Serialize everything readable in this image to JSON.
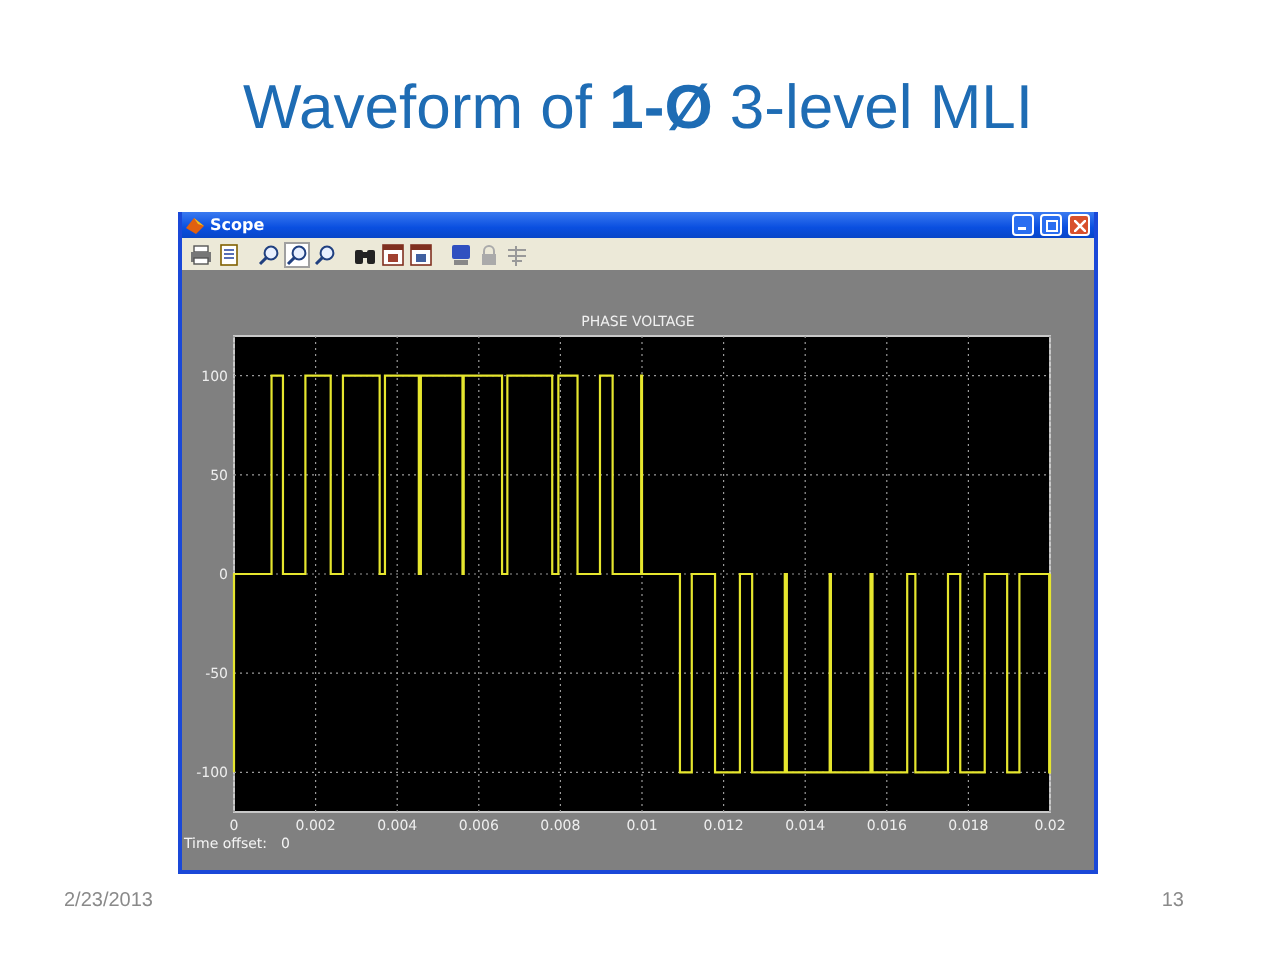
{
  "slide": {
    "title": "Waveform of **1-Ø** 3-level MLI",
    "date": "2/23/2013",
    "page_number": "13"
  },
  "scope_window": {
    "title": "Scope",
    "toolbar_buttons": [
      {
        "kind": "print",
        "selected": false
      },
      {
        "kind": "parameters",
        "selected": false
      },
      {
        "kind": "zoom",
        "selected": false
      },
      {
        "kind": "zoom",
        "selected": true
      },
      {
        "kind": "zoom",
        "selected": false
      },
      {
        "kind": "autoscale",
        "selected": false
      },
      {
        "kind": "save",
        "selected": false
      },
      {
        "kind": "restore",
        "selected": false
      },
      {
        "kind": "float",
        "selected": false
      },
      {
        "kind": "lock",
        "selected": false
      },
      {
        "kind": "signals",
        "selected": false
      }
    ],
    "plot": {
      "chart_data": {
        "type": "line",
        "grid": true,
        "title": "PHASE VOLTAGE",
        "xlim": [
          0,
          0.02
        ],
        "ylim": [
          -120,
          120
        ],
        "xticks": [
          0,
          0.002,
          0.004,
          0.006,
          0.008,
          0.01,
          0.012,
          0.014,
          0.016,
          0.018,
          0.02
        ],
        "yticks": [
          -100,
          -50,
          0,
          50,
          100
        ],
        "x": [
          0,
          0,
          0.00092,
          0.00092,
          0.0012,
          0.0012,
          0.00175,
          0.00175,
          0.00237,
          0.00237,
          0.00267,
          0.00267,
          0.00357,
          0.00357,
          0.0037,
          0.0037,
          0.00453,
          0.00453,
          0.00458,
          0.00458,
          0.0056,
          0.0056,
          0.00563,
          0.00563,
          0.00657,
          0.00657,
          0.0067,
          0.0067,
          0.0078,
          0.0078,
          0.00795,
          0.00795,
          0.00842,
          0.00842,
          0.00897,
          0.00897,
          0.00928,
          0.00928,
          0.00998,
          0.00998,
          0.01,
          0.01,
          0.01093,
          0.01093,
          0.01122,
          0.01122,
          0.01179,
          0.01179,
          0.0124,
          0.0124,
          0.0127,
          0.0127,
          0.0135,
          0.0135,
          0.01355,
          0.01355,
          0.0146,
          0.0146,
          0.01463,
          0.01463,
          0.0156,
          0.0156,
          0.01565,
          0.01565,
          0.0165,
          0.0165,
          0.0167,
          0.0167,
          0.0175,
          0.0175,
          0.0178,
          0.0178,
          0.0184,
          0.0184,
          0.01895,
          0.01895,
          0.01925,
          0.01925,
          0.01998,
          0.01998,
          0.02,
          0.02
        ],
        "series": [
          {
            "color": "#e6e62e",
            "values": [
              -100,
              0,
              0,
              100,
              100,
              0,
              0,
              100,
              100,
              0,
              0,
              100,
              100,
              0,
              0,
              100,
              100,
              0,
              0,
              100,
              100,
              0,
              0,
              100,
              100,
              0,
              0,
              100,
              100,
              0,
              0,
              100,
              100,
              0,
              0,
              100,
              100,
              0,
              0,
              100,
              100,
              0,
              0,
              -100,
              -100,
              0,
              0,
              -100,
              -100,
              0,
              0,
              -100,
              -100,
              0,
              0,
              -100,
              -100,
              0,
              0,
              -100,
              -100,
              0,
              0,
              -100,
              -100,
              0,
              0,
              -100,
              -100,
              0,
              0,
              -100,
              -100,
              0,
              0,
              -100,
              -100,
              0,
              0,
              -100,
              -100,
              0
            ]
          }
        ]
      }
    },
    "time_offset_label": "Time offset:",
    "time_offset_value": "0"
  }
}
